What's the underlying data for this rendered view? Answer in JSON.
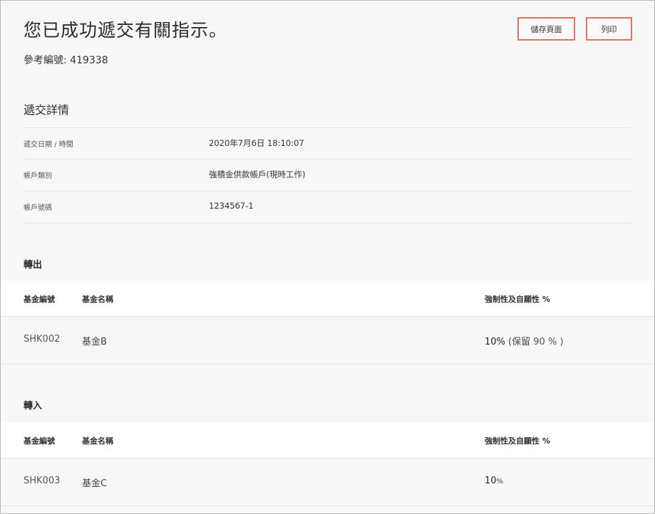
{
  "header": {
    "title": "您已成功遞交有關指示。",
    "reference_label": "參考編號:",
    "reference_number": "419338"
  },
  "actions": {
    "save_label": "儲存頁面",
    "print_label": "列印"
  },
  "details": {
    "title": "遞交詳情",
    "rows": [
      {
        "label": "遞交日期 / 時間",
        "value": "2020年7月6日 18:10:07"
      },
      {
        "label": "帳戶類別",
        "value": "強積金供款帳戶(現時工作)"
      },
      {
        "label": "帳戶號碼",
        "value": "1234567-1"
      }
    ]
  },
  "transfer_out": {
    "title": "轉出",
    "headers": {
      "code": "基金編號",
      "name": "基金名稱",
      "pct": "強制性及自願性 %"
    },
    "rows": [
      {
        "code": "SHK002",
        "name": "基金B",
        "pct": "10%",
        "keep_label": "(保留",
        "keep_value": "90",
        "keep_suffix": "% )"
      }
    ]
  },
  "transfer_in": {
    "title": "轉入",
    "headers": {
      "code": "基金編號",
      "name": "基金名稱",
      "pct": "強制性及自願性 %"
    },
    "rows": [
      {
        "code": "SHK003",
        "name": "基金C",
        "pct_value": "10",
        "pct_sign": "%"
      }
    ]
  },
  "colors": {
    "accent_border": "#e0705f",
    "background": "#f7f7f8"
  }
}
